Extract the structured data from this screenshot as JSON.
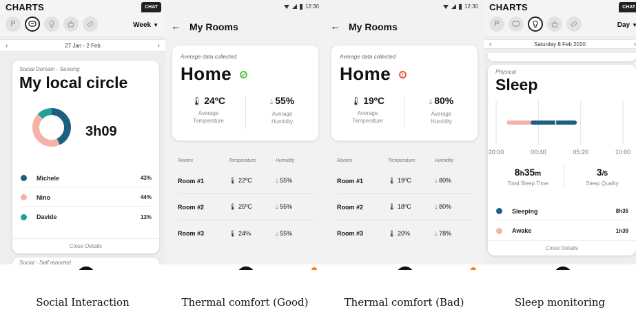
{
  "colors": {
    "orange": "#f5841f",
    "teal_dark": "#1d5f80",
    "pink": "#f4b3a6",
    "teal": "#21a195",
    "green": "#5bc44c",
    "red": "#e8593c",
    "dark": "#111111"
  },
  "social": {
    "app_title": "CHARTS",
    "chat_label": "CHAT",
    "domain_p": "P",
    "period": "Week",
    "date_range": "27 Jan - 2 Feb",
    "category": "Social Domain - Sensing",
    "title": "My local circle",
    "total": "3h09",
    "legend": [
      {
        "name": "Michele",
        "pct": "43%",
        "value": 43,
        "color": "#1d5f80"
      },
      {
        "name": "Nino",
        "pct": "44%",
        "value": 44,
        "color": "#f4b3a6"
      },
      {
        "name": "Davide",
        "pct": "13%",
        "value": 13,
        "color": "#21a195"
      }
    ],
    "close": "Close Details",
    "next_category": "Social - Self reported"
  },
  "rooms_good": {
    "time": "12:30",
    "title": "My Rooms",
    "subtitle": "Average data collected",
    "home": "Home",
    "temperature": "24ºC",
    "humidity": "55%",
    "temp_label": "Average Temperature",
    "hum_label": "Average Humidity",
    "headers": [
      "Rooms",
      "Temperature",
      "Humidity"
    ],
    "rows": [
      {
        "room": "Room #1",
        "temp": "22ºC",
        "hum": "55%"
      },
      {
        "room": "Room #2",
        "temp": "25ºC",
        "hum": "55%"
      },
      {
        "room": "Room #3",
        "temp": "24%",
        "hum": "55%"
      }
    ]
  },
  "rooms_bad": {
    "time": "12:30",
    "title": "My Rooms",
    "subtitle": "Average data collected",
    "home": "Home",
    "temperature": "19ºC",
    "humidity": "80%",
    "temp_label": "Average Temperature",
    "hum_label": "Average Humidity",
    "headers": [
      "Rooms",
      "Temperature",
      "Humidity"
    ],
    "rows": [
      {
        "room": "Room #1",
        "temp": "19ºC",
        "hum": "80%"
      },
      {
        "room": "Room #2",
        "temp": "18ºC",
        "hum": "80%"
      },
      {
        "room": "Room #3",
        "temp": "20%",
        "hum": "78%"
      }
    ]
  },
  "sleep": {
    "app_title": "CHARTS",
    "chat_label": "CHAT",
    "domain_p": "P",
    "period": "Day",
    "date": "Saturday 8 Feb 2020",
    "category": "Physical",
    "title": "Sleep",
    "ticks": [
      "20:00",
      "00:40",
      "05:20",
      "10:00"
    ],
    "sleep_start": 0.5,
    "sleep_end": 9.3,
    "awake_start": 0.3,
    "awake_end": 0.9,
    "total_h": "8",
    "total_h_unit": "h",
    "total_m": "35",
    "total_m_unit": "m",
    "total_label": "Total Sleep Time",
    "quality": "3",
    "quality_unit": "/5",
    "quality_label": "Sleep Quality",
    "legend": [
      {
        "name": "Sleeping",
        "value": "8h35",
        "color": "#1d5f80"
      },
      {
        "name": "Awake",
        "value": "1h39",
        "color": "#f4b3a6"
      }
    ],
    "close": "Close Details"
  },
  "captions": [
    "Social Interaction",
    "Thermal comfort (Good)",
    "Thermal comfort (Bad)",
    "Sleep monitoring"
  ]
}
